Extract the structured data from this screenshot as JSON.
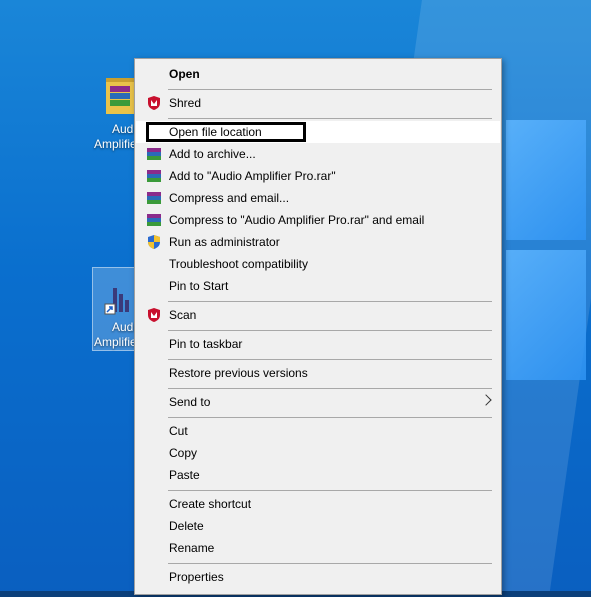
{
  "desktop": {
    "icons": [
      {
        "label_line1": "Audio",
        "label_line2": "Amplifier"
      },
      {
        "label_line1": "Audio",
        "label_line2": "Amplifier"
      }
    ]
  },
  "context_menu": {
    "open": "Open",
    "shred": "Shred",
    "open_file_location": "Open file location",
    "add_to_archive": "Add to archive...",
    "add_to_rar": "Add to \"Audio Amplifier Pro.rar\"",
    "compress_email": "Compress and email...",
    "compress_rar_email": "Compress to \"Audio Amplifier Pro.rar\" and email",
    "run_as_admin": "Run as administrator",
    "troubleshoot": "Troubleshoot compatibility",
    "pin_start": "Pin to Start",
    "scan": "Scan",
    "pin_taskbar": "Pin to taskbar",
    "restore_versions": "Restore previous versions",
    "send_to": "Send to",
    "cut": "Cut",
    "copy": "Copy",
    "paste": "Paste",
    "create_shortcut": "Create shortcut",
    "delete": "Delete",
    "rename": "Rename",
    "properties": "Properties"
  },
  "colors": {
    "desktop_blue": "#0a6fce",
    "menu_bg": "#f0f0f0",
    "mcafee_red": "#c8102e",
    "focus_border": "#000000"
  }
}
